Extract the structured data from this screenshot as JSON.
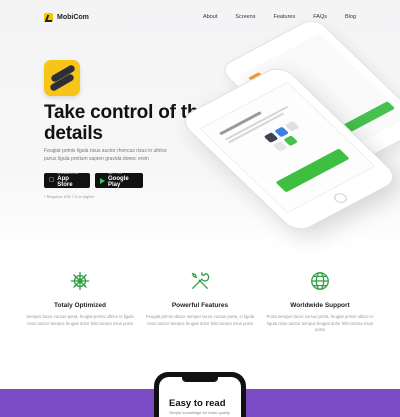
{
  "brand": {
    "name": "MobiCom",
    "logo_icon": "mobicom-logo-icon"
  },
  "nav": {
    "items": [
      "About",
      "Screens",
      "Features",
      "FAQs",
      "Blog"
    ]
  },
  "hero": {
    "app_icon": "app-icon",
    "headline": "Take control of the details",
    "subtext": "Feugiat primis ligula risus auctor rhoncus risus in ultrice purus ligula pretium sapien gravida donec enim",
    "app_store": {
      "small": "Download on the",
      "big": "App Store"
    },
    "google_play": {
      "small": "GET IT ON",
      "big": "Google Play"
    },
    "note": "* Requires iOS 7.0 or higher"
  },
  "features": [
    {
      "icon": "ship-wheel-icon",
      "title": "Totaly Optimized",
      "text": "Semper lacus cursus porta, feugiat primis ultrice in ligula risus auctor tempus feugiat dolor felis lacinia risus porta"
    },
    {
      "icon": "tools-icon",
      "title": "Powerful Features",
      "text": "Feugiat primis ultrice semper lacus cursus porta, in ligula risus auctor tempus feugiat dolor felis lacinia risus porta"
    },
    {
      "icon": "globe-icon",
      "title": "Worldwide Support",
      "text": "Porta semper lacus cursus porta, feugiat primis ultrice in ligula risus auctor tempus feugiat dolor felis lacinia risus porta"
    }
  ],
  "showcase": {
    "title": "Easy to read",
    "subtitle": "Simple knowledge for team quality"
  },
  "colors": {
    "accent_green": "#3fbf3f",
    "accent_yellow": "#f6c517",
    "band_purple": "#7b4cc6",
    "icon_green": "#2f9e44"
  }
}
